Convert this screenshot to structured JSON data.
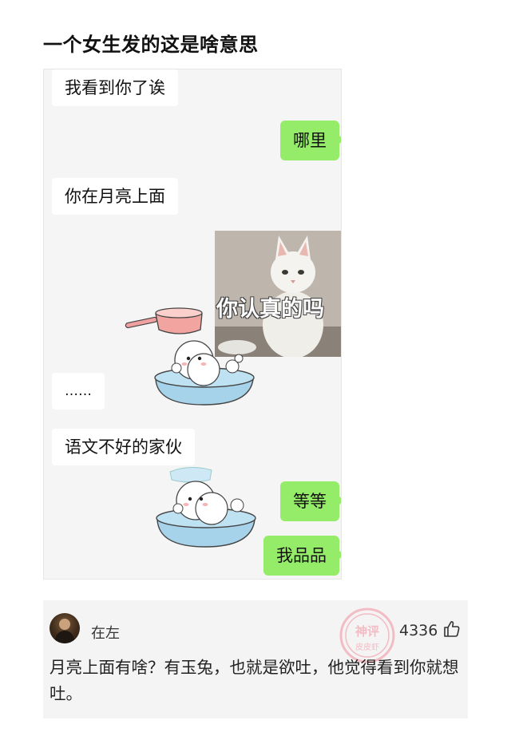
{
  "post": {
    "title": "一个女生发的这是啥意思"
  },
  "chat": {
    "messages": [
      {
        "side": "left",
        "text": "我看到你了诶"
      },
      {
        "side": "right",
        "text": "哪里"
      },
      {
        "side": "left",
        "text": "你在月亮上面"
      },
      {
        "side": "right",
        "sticker": "cat-meme",
        "caption": "你认真的吗"
      },
      {
        "side": "left",
        "sticker": "bath-dog"
      },
      {
        "side": "left",
        "text": "……"
      },
      {
        "side": "left",
        "text": "语文不好的家伙"
      },
      {
        "side": "left",
        "sticker": "bath-dog"
      },
      {
        "side": "right",
        "text": "等等"
      },
      {
        "side": "right",
        "text": "我品品"
      }
    ],
    "colors": {
      "outgoing_bubble": "#95ec69",
      "incoming_bubble": "#ffffff",
      "background": "#f5f5f5"
    }
  },
  "comment": {
    "username": "在左",
    "likes": "4336",
    "text": "月亮上面有啥？有玉兔，也就是欲吐，他觉得看到你就想吐。",
    "stamp": {
      "line1": "神评",
      "line2": "皮皮虾"
    },
    "icons": {
      "avatar": "user-avatar",
      "like": "thumbs-up-icon"
    }
  }
}
